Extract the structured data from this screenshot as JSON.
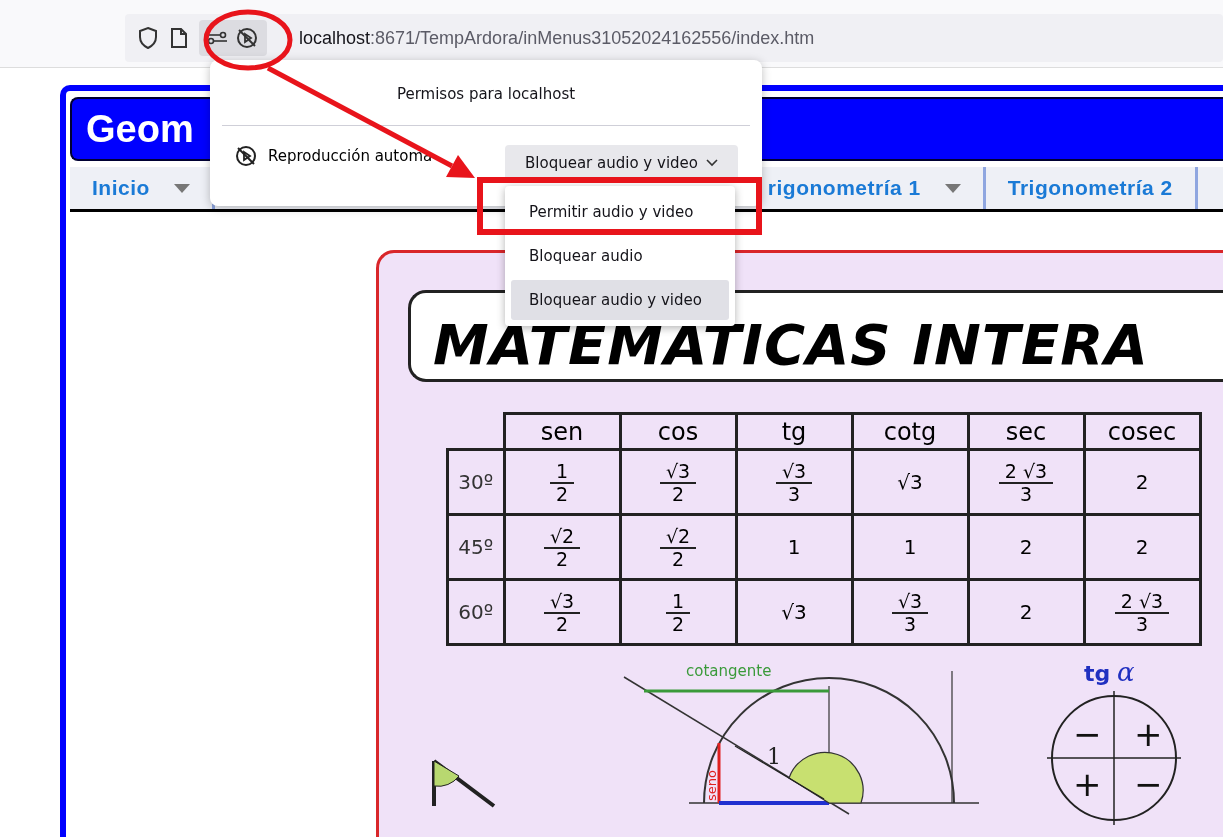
{
  "browser": {
    "address": {
      "host": "localhost",
      "path": ":8671/TempArdora/inMenus31052024162556/index.htm"
    }
  },
  "page": {
    "title": "Geom",
    "menu": [
      {
        "label": "Inicio",
        "has_menu": true,
        "kind": "first"
      },
      {
        "label": "rigonometría 1",
        "has_menu": true,
        "kind": "after-popup"
      },
      {
        "label": "Trigonometría 2",
        "has_menu": false,
        "kind": "normal"
      }
    ],
    "poster": {
      "title": "MATEMATICAS INTERA",
      "table": {
        "columns": [
          "sen",
          "cos",
          "tg",
          "cotg",
          "sec",
          "cosec"
        ],
        "rows": [
          {
            "angle": "30º",
            "cells": [
              {
                "num": "1",
                "den": "2"
              },
              {
                "num": "√3",
                "den": "2"
              },
              {
                "num": "√3",
                "den": "3"
              },
              {
                "value": "√3"
              },
              {
                "num": "2 √3",
                "den": "3"
              },
              {
                "value": "2"
              }
            ]
          },
          {
            "angle": "45º",
            "cells": [
              {
                "num": "√2",
                "den": "2"
              },
              {
                "num": "√2",
                "den": "2"
              },
              {
                "value": "1"
              },
              {
                "value": "1"
              },
              {
                "value": "2"
              },
              {
                "value": "2"
              }
            ]
          },
          {
            "angle": "60º",
            "cells": [
              {
                "num": "√3",
                "den": "2"
              },
              {
                "num": "1",
                "den": "2"
              },
              {
                "value": "√3"
              },
              {
                "num": "√3",
                "den": "3"
              },
              {
                "value": "2"
              },
              {
                "num": "2 √3",
                "den": "3"
              }
            ]
          }
        ]
      },
      "diagram": {
        "cotangent_label": "cotangente",
        "radius_label": "1",
        "sine_label": "seno",
        "tan_title": "tg",
        "tan_symbol": "α",
        "signs": [
          "−",
          "+",
          "+",
          "−"
        ]
      }
    }
  },
  "permissions_popup": {
    "title": "Permisos para localhost",
    "setting_label": "Reproducción automa",
    "dropdown_value": "Bloquear audio y video",
    "options": [
      {
        "label": "Permitir audio y video",
        "selected": false
      },
      {
        "label": "Bloquear audio",
        "selected": false
      },
      {
        "label": "Bloquear audio y video",
        "selected": true
      }
    ]
  }
}
